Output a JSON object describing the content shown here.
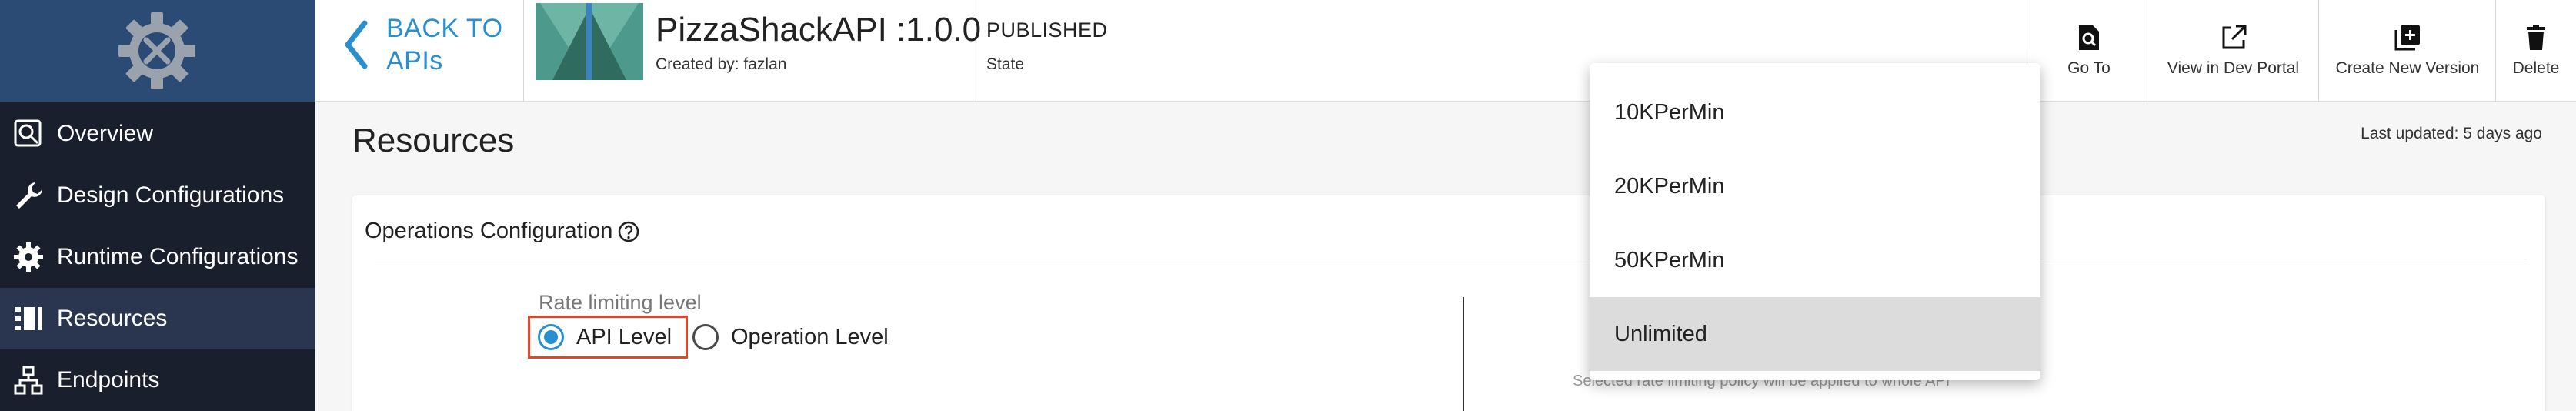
{
  "sidebar": {
    "items": [
      {
        "label": "Overview",
        "icon": "overview-icon"
      },
      {
        "label": "Design Configurations",
        "icon": "wrench-icon"
      },
      {
        "label": "Runtime Configurations",
        "icon": "gear-icon"
      },
      {
        "label": "Resources",
        "icon": "resources-icon"
      },
      {
        "label": "Endpoints",
        "icon": "endpoints-icon"
      }
    ],
    "active_index": 3
  },
  "header": {
    "back_line1": "BACK TO",
    "back_line2": "APIs",
    "api_name": "PizzaShackAPI :1.0.0",
    "created_by": "Created by: fazlan",
    "state_value": "PUBLISHED",
    "state_label": "State",
    "toolbar": {
      "goto_label": "Go To",
      "dev_portal_label": "View in Dev Portal",
      "new_version_label": "Create New Version",
      "delete_label": "Delete"
    }
  },
  "main": {
    "title": "Resources",
    "last_updated": "Last updated: 5 days ago",
    "ops_title": "Operations Configuration",
    "rate_limiting_label": "Rate limiting level",
    "api_level_label": "API Level",
    "operation_level_label": "Operation Level",
    "hint": "Selected rate limiting policy will be applied to whole API"
  },
  "dropdown": {
    "options": [
      "10KPerMin",
      "20KPerMin",
      "50KPerMin",
      "Unlimited"
    ],
    "selected_index": 3
  },
  "colors": {
    "sidebar_bg": "#1a1f2e",
    "logo_bg": "#2b4a74",
    "accent": "#2a8fcf",
    "highlight_box": "#e0462a"
  }
}
